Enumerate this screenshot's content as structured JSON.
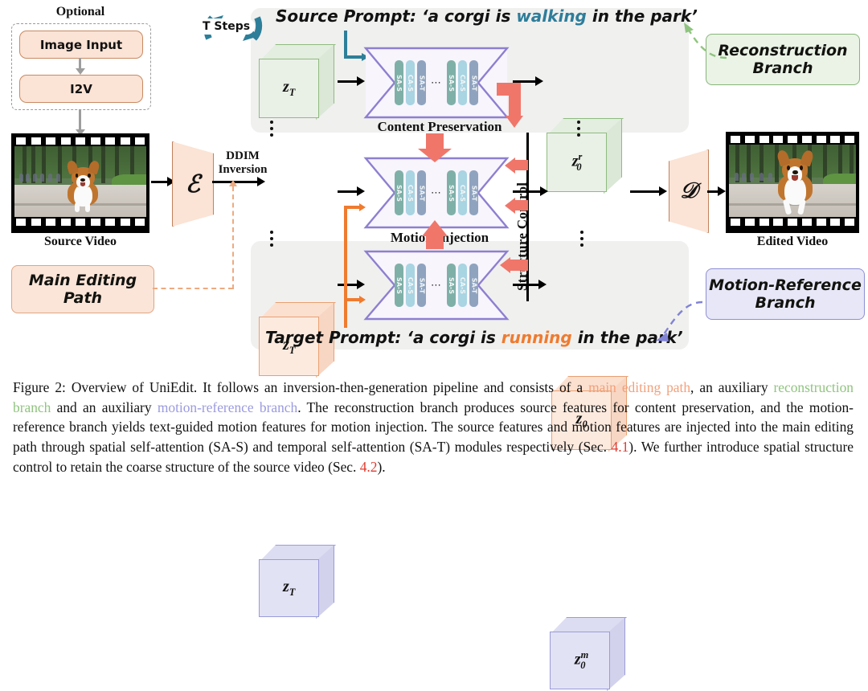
{
  "figure": {
    "optional": {
      "caption": "Optional",
      "steps": [
        "Image Input",
        "I2V"
      ]
    },
    "source_video_label": "Source Video",
    "edited_video_label": "Edited Video",
    "encoder_glyph": "ℰ",
    "decoder_glyph": "𝒟",
    "ddim_label_line1": "DDIM",
    "ddim_label_line2": "Inversion",
    "t_steps_label": "T Steps",
    "structure_control_label": "Structure Control",
    "content_preservation_label": "Content Preservation",
    "motion_injection_label": "Motion Injection",
    "prompts": {
      "source": {
        "prefix": "Source Prompt: ‘a corgi is ",
        "highlight": "walking",
        "suffix": " in the park’",
        "highlight_color": "#2e7d9a"
      },
      "target": {
        "prefix": "Target Prompt: ‘a corgi is ",
        "highlight": "running",
        "suffix": " in the park’",
        "highlight_color": "#ef7b2f"
      }
    },
    "branch_tags": {
      "reconstruction": "Reconstruction\nBranch",
      "motion_reference": "Motion-Reference\nBranch",
      "main_editing": "Main Editing\nPath"
    },
    "latents": {
      "recon_in": "z_T",
      "recon_out": "z_0^r",
      "main_in": "z_T",
      "main_out": "z_0",
      "motion_in": "z_T",
      "motion_out": "z_0^m"
    },
    "unet_blocks": [
      "SA-S",
      "CA-S",
      "SA-T",
      "⋯",
      "SA-S",
      "CA-S",
      "SA-T"
    ],
    "unet_block_colors": {
      "SA-S": "#7fb0a8",
      "CA-S": "#a9d4e2",
      "SA-T": "#8fa3bf"
    },
    "colors": {
      "panel_gray": "#f0f0ef",
      "green_branch": "#86b678",
      "purple_branch": "#8e8fd4",
      "orange_path": "#ef7b2f",
      "red_arrow": "#f0766a",
      "teal_arrow": "#2d7f99",
      "unet_outline": "#8e7fd0"
    }
  },
  "caption": {
    "seg1": "Figure 2: Overview of UniEdit. It follows an inversion-then-generation pipeline and consists of a ",
    "main": "main editing path",
    "seg2": ", an auxiliary ",
    "recon": "reconstruction branch",
    "seg3": " and an auxiliary ",
    "motion": "motion-reference branch",
    "seg4": ". The reconstruction branch produces source features for content preservation, and the motion-reference branch yields text-guided motion features for motion injection. The source features and motion features are injected into the main editing path through spatial self-attention (SA-S) and temporal self-attention (SA-T) modules respectively (Sec. ",
    "sec1": "4.1",
    "seg5": "). We further introduce spatial structure control to retain the coarse structure of the source video (Sec. ",
    "sec2": "4.2",
    "seg6": ")."
  }
}
